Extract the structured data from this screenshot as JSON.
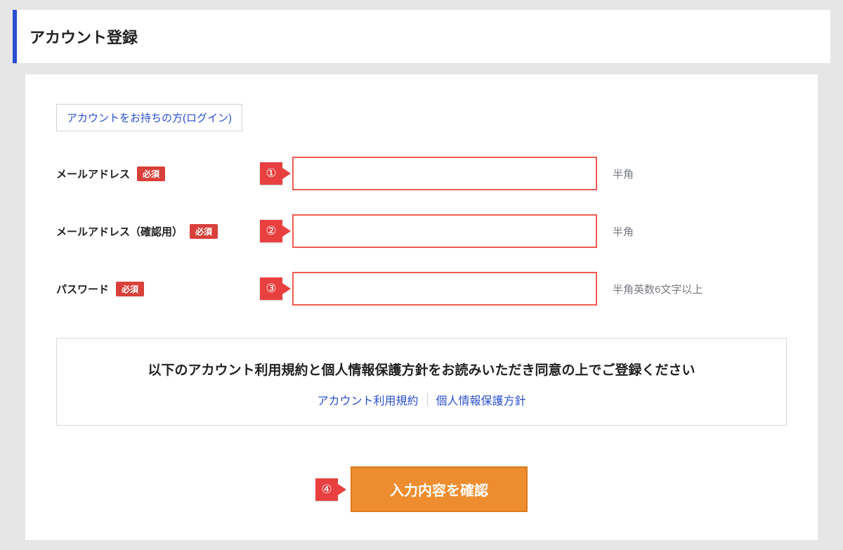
{
  "header": {
    "title": "アカウント登録"
  },
  "loginLink": {
    "label": "アカウントをお持ちの方(ログイン)"
  },
  "badges": {
    "required": "必須"
  },
  "fields": {
    "email": {
      "label": "メールアドレス",
      "hint": "半角",
      "callout": "①"
    },
    "emailConfirm": {
      "label": "メールアドレス（確認用）",
      "hint": "半角",
      "callout": "②"
    },
    "password": {
      "label": "パスワード",
      "hint": "半角英数6文字以上",
      "callout": "③"
    }
  },
  "terms": {
    "heading": "以下のアカウント利用規約と個人情報保護方針をお読みいただき同意の上でご登録ください",
    "link1": "アカウント利用規約",
    "link2": "個人情報保護方針"
  },
  "submit": {
    "label": "入力内容を確認",
    "callout": "④"
  }
}
